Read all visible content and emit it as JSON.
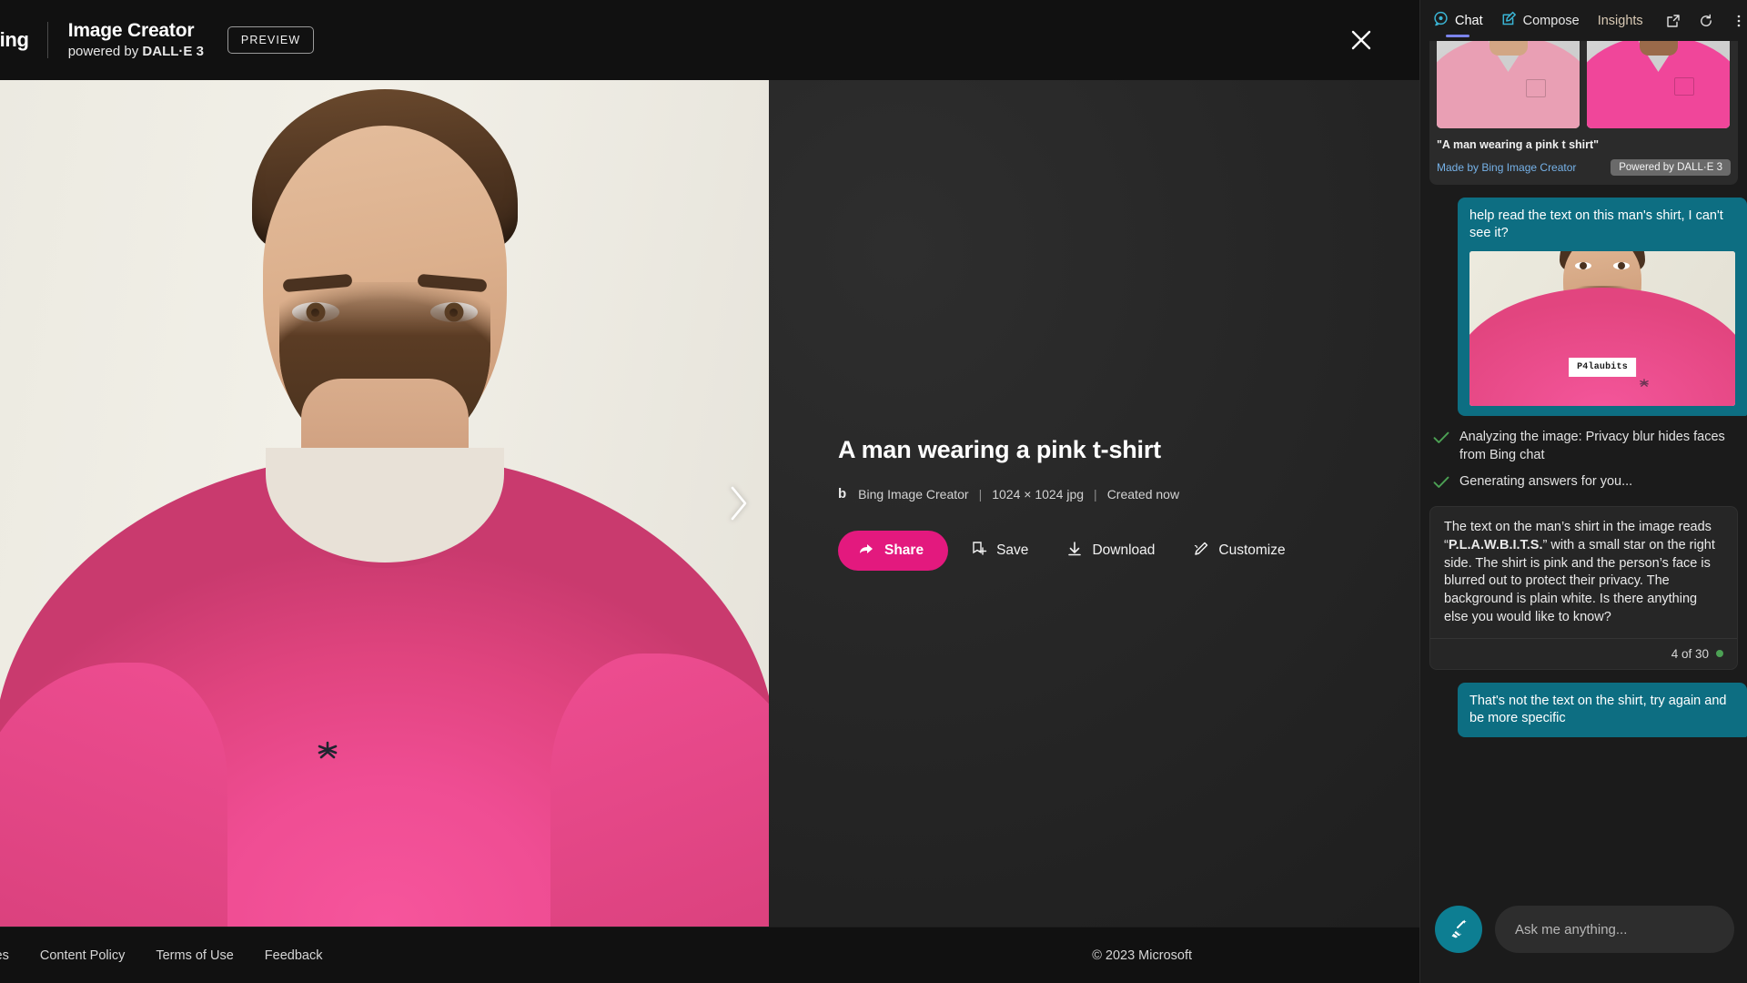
{
  "header": {
    "bing_label": "Bing",
    "title": "Image Creator",
    "subtitle_prefix": "powered by ",
    "subtitle_brand": "DALL·E 3",
    "preview_badge": "PREVIEW",
    "close_icon": "close-icon"
  },
  "viewer": {
    "next_arrow_icon": "chevron-right-icon",
    "shirt_logo_icon": "shirt-emblem-icon"
  },
  "details": {
    "title": "A man wearing a pink t-shirt",
    "source_glyph": "b",
    "source": "Bing Image Creator",
    "dimensions": "1024 × 1024 jpg",
    "created": "Created now",
    "separator": "|",
    "actions": [
      {
        "label": "Share",
        "icon": "share-icon",
        "primary": true
      },
      {
        "label": "Save",
        "icon": "save-icon",
        "primary": false
      },
      {
        "label": "Download",
        "icon": "download-icon",
        "primary": false
      },
      {
        "label": "Customize",
        "icon": "customize-pen-icon",
        "primary": false
      }
    ]
  },
  "footer": {
    "links": [
      "okies",
      "Content Policy",
      "Terms of Use",
      "Feedback"
    ],
    "copyright": "© 2023 Microsoft"
  },
  "sidebar": {
    "tabs": [
      {
        "label": "Chat",
        "icon": "chat-bubble-icon",
        "active": true
      },
      {
        "label": "Compose",
        "icon": "compose-pencil-icon",
        "active": false
      },
      {
        "label": "Insights",
        "icon": "",
        "active": false
      }
    ],
    "icons": [
      "open-in-new-icon",
      "refresh-icon",
      "more-options-icon"
    ],
    "generated_card": {
      "caption": "\"A man wearing a pink t shirt\"",
      "made_by": "Made by Bing Image Creator",
      "badge": "Powered by DALL·E 3",
      "thumb_colors": [
        "#e99fb4",
        "#f0469a"
      ]
    },
    "messages": [
      {
        "role": "user",
        "text": "help read the text on this man's shirt, I can't see it?",
        "attachment_label": "P4laubits"
      },
      {
        "role": "status",
        "text": "Analyzing the image: Privacy blur hides faces from Bing chat",
        "icon": "check-icon"
      },
      {
        "role": "status",
        "text": "Generating answers for you...",
        "icon": "check-icon"
      },
      {
        "role": "bot",
        "text_before": "The text on the man’s shirt in the image reads “",
        "bold": "P.L.A.W.B.I.T.S.",
        "text_after": "” with a small star on the right side. The shirt is pink and the person’s face is blurred out to protect their privacy. The background is plain white. Is there anything else you would like to know?",
        "count": "4 of 30"
      },
      {
        "role": "user",
        "text": "That's not the text on the shirt, try again and be more specific"
      }
    ],
    "composer": {
      "broom_icon": "broom-icon",
      "placeholder": "Ask me anything..."
    }
  },
  "colors": {
    "accent_pink": "#e3197e",
    "user_bubble": "#0d6e82",
    "tab_underline": "#7b83eb",
    "status_check": "#4ca154",
    "count_dot": "#4ca154"
  }
}
